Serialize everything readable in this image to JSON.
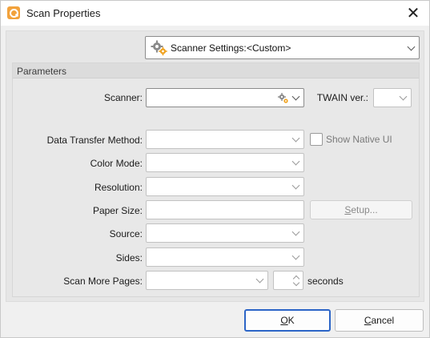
{
  "window": {
    "title": "Scan Properties",
    "accent": "#2c65c7",
    "icon": "pdf-xchange-app-icon"
  },
  "settings": {
    "label": "Scanner Settings:",
    "value": "<Custom>",
    "icon": "gears-icon"
  },
  "parameters": {
    "title": "Parameters",
    "scanner_label": "Scanner:",
    "scanner_value": "",
    "twain_label": "TWAIN ver.:",
    "twain_value": "",
    "data_transfer_label": "Data Transfer Method:",
    "show_native_ui_label": "Show Native UI",
    "show_native_ui_checked": false,
    "color_mode_label": "Color Mode:",
    "resolution_label": "Resolution:",
    "paper_size_label": "Paper Size:",
    "setup_prefix": "S",
    "setup_rest": "etup...",
    "source_label": "Source:",
    "sides_label": "Sides:",
    "scan_more_label": "Scan More Pages:",
    "scan_more_value": "",
    "seconds_value": "",
    "seconds_label": "seconds"
  },
  "footer": {
    "ok_prefix": "O",
    "ok_rest": "K",
    "cancel_prefix": "C",
    "cancel_rest": "ancel"
  }
}
